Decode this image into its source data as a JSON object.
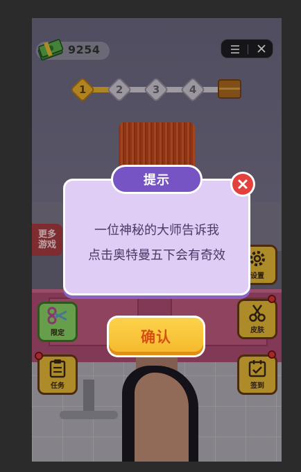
{
  "hud": {
    "money_value": "9254",
    "capsule_menu_icon": "menu-icon",
    "capsule_close_icon": "close-icon"
  },
  "progress": {
    "steps": [
      "1",
      "2",
      "3",
      "4"
    ],
    "current_step": 1,
    "reward_icon": "treasure-chest-icon"
  },
  "side_buttons": {
    "more_games": [
      "更多",
      "游戏"
    ],
    "limited": "限定",
    "task": "任务",
    "settings": "设置",
    "skin": "皮肤",
    "checkin": "签到"
  },
  "dialog": {
    "title": "提示",
    "line1": "一位神秘的大师告诉我",
    "line2": "点击奥特曼五下会有奇效",
    "confirm_label": "确认"
  },
  "colors": {
    "dialog_bg": "#e0cdf5",
    "title_pill": "#7654c4",
    "confirm": "#f5b82a",
    "close": "#e3413d"
  }
}
